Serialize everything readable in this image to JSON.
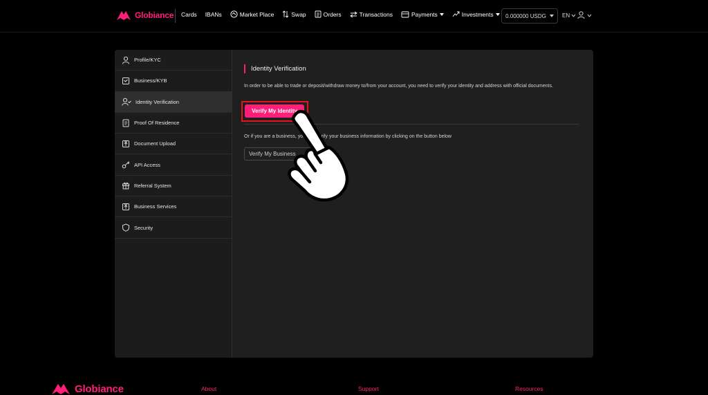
{
  "brand": {
    "name": "Globiance",
    "accent": "#ff1f78"
  },
  "nav": {
    "items": [
      {
        "label": "Cards",
        "icon": ""
      },
      {
        "label": "IBANs",
        "icon": ""
      },
      {
        "label": "Market Place",
        "icon": "marketplace-icon"
      },
      {
        "label": "Swap",
        "icon": "swap-icon"
      },
      {
        "label": "Orders",
        "icon": "orders-icon"
      },
      {
        "label": "Transactions",
        "icon": "transactions-icon"
      },
      {
        "label": "Payments",
        "icon": "payments-icon",
        "dropdown": true
      },
      {
        "label": "Investments",
        "icon": "investments-icon",
        "dropdown": true
      }
    ],
    "balance": "0.000000 USDG",
    "language": "EN"
  },
  "sidebar": {
    "items": [
      {
        "label": "Profile/KYC",
        "icon": "user-icon"
      },
      {
        "label": "Business/KYB",
        "icon": "briefcase-icon"
      },
      {
        "label": "Identity Verification",
        "icon": "user-check-icon",
        "active": true
      },
      {
        "label": "Proof Of Residence",
        "icon": "document-icon"
      },
      {
        "label": "Document Upload",
        "icon": "upload-icon"
      },
      {
        "label": "API Access",
        "icon": "key-icon"
      },
      {
        "label": "Referral System",
        "icon": "gift-icon"
      },
      {
        "label": "Business Services",
        "icon": "upload-icon"
      },
      {
        "label": "Security",
        "icon": "shield-icon"
      }
    ]
  },
  "main": {
    "title": "Identity Verification",
    "description": "In order to be able to trade or deposit/withdraw money to/from your account, you need to verify your identity and address with official documents.",
    "verify_identity_label": "Verify My Identity",
    "business_description": "Or if you are a business, you can verify your business information by clicking on the button below",
    "verify_business_label": "Verify My Business"
  },
  "footer": {
    "columns": [
      "About",
      "Support",
      "Resources"
    ]
  }
}
